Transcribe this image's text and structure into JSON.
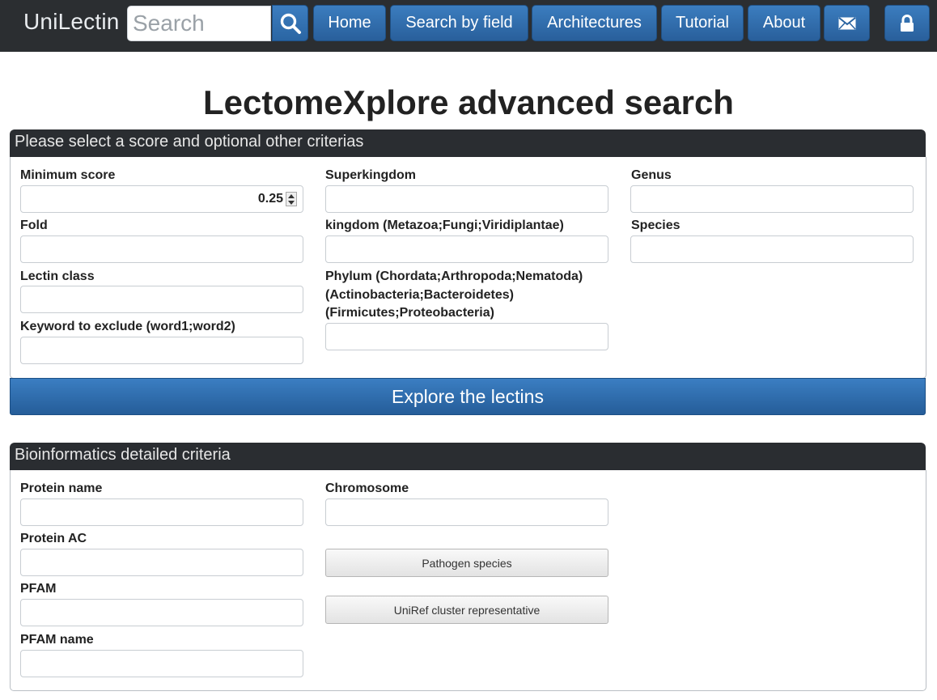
{
  "navbar": {
    "brand": "UniLectin",
    "search_placeholder": "Search",
    "buttons": [
      "Home",
      "Search by field",
      "Architectures",
      "Tutorial",
      "About"
    ],
    "icons": [
      "search-icon",
      "envelope-icon",
      "lock-icon"
    ]
  },
  "page": {
    "title": "LectomeXplore advanced search"
  },
  "panel1": {
    "header": "Please select a score and optional other criterias",
    "min_score_label": "Minimum score",
    "min_score_value": "0.25",
    "fold_label": "Fold",
    "lectin_class_label": "Lectin class",
    "keyword_exclude_label": "Keyword to exclude (word1;word2)",
    "superkingdom_label": "Superkingdom",
    "kingdom_label": "kingdom (Metazoa;Fungi;Viridiplantae)",
    "phylum_label_line1": "Phylum (Chordata;Arthropoda;Nematoda)",
    "phylum_label_line2": "(Actinobacteria;Bacteroidetes)",
    "phylum_label_line3": "(Firmicutes;Proteobacteria)",
    "genus_label": "Genus",
    "species_label": "Species",
    "explore_button": "Explore the lectins"
  },
  "panel2": {
    "header": "Bioinformatics detailed criteria",
    "protein_name_label": "Protein name",
    "protein_ac_label": "Protein AC",
    "pfam_label": "PFAM",
    "pfam_name_label": "PFAM name",
    "chromosome_label": "Chromosome",
    "pathogen_button": "Pathogen species",
    "uniref_button": "UniRef cluster representative"
  }
}
